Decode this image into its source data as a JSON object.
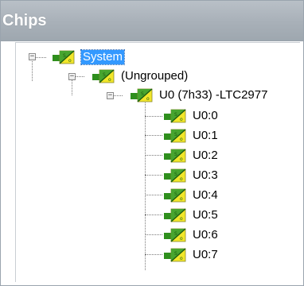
{
  "panel": {
    "title": "Chips"
  },
  "tree": {
    "system": {
      "label": "System",
      "expander": "−"
    },
    "group": {
      "label": "(Ungrouped)",
      "expander": "−"
    },
    "chip": {
      "label": "U0 (7h33) -LTC2977",
      "expander": "−"
    },
    "channels": [
      "U0:0",
      "U0:1",
      "U0:2",
      "U0:3",
      "U0:4",
      "U0:5",
      "U0:6",
      "U0:7"
    ]
  },
  "icons": {
    "node_icon": "chip-icon",
    "colors": {
      "green": "#2f8f1d",
      "yellow": "#f1e62a",
      "line": "#1c5c10"
    }
  }
}
